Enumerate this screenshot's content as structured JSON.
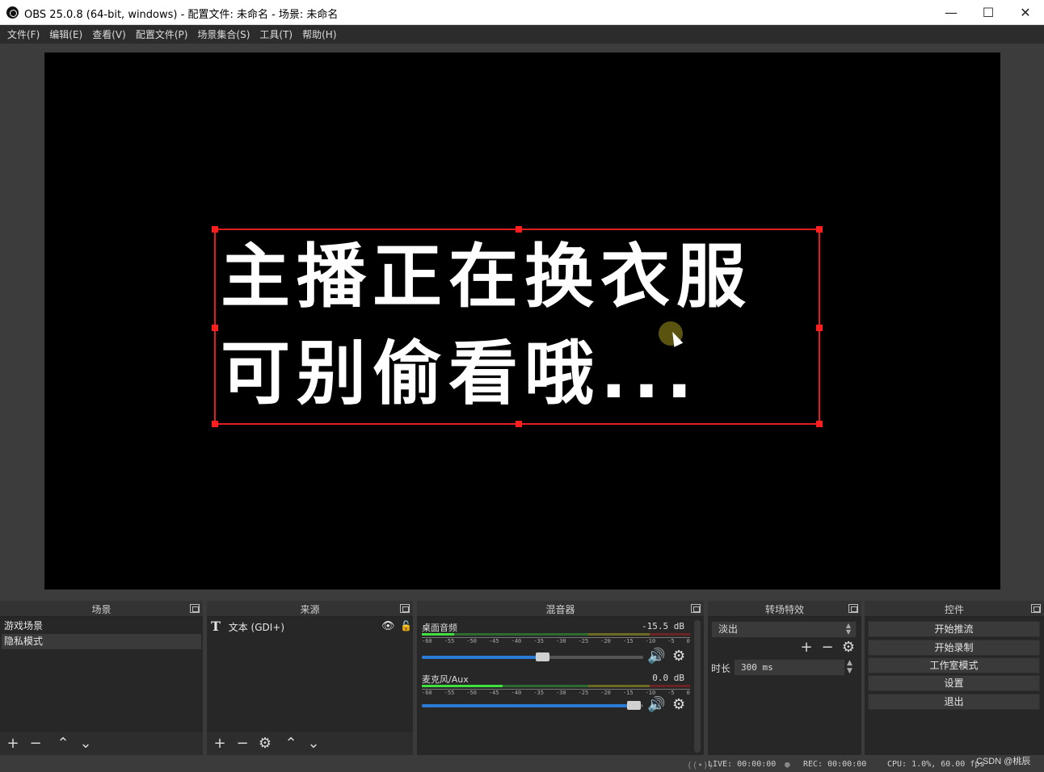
{
  "window": {
    "title": "OBS 25.0.8 (64-bit, windows) - 配置文件: 未命名 - 场景: 未命名",
    "minimize": "—",
    "maximize": "☐",
    "close": "✕"
  },
  "menu": [
    "文件(F)",
    "编辑(E)",
    "查看(V)",
    "配置文件(P)",
    "场景集合(S)",
    "工具(T)",
    "帮助(H)"
  ],
  "preview": {
    "overlay_line1": "主播正在换衣服",
    "overlay_line2": "可别偷看哦..."
  },
  "scenes": {
    "title": "场景",
    "items": [
      "游戏场景",
      "隐私模式"
    ],
    "selected_index": 1
  },
  "sources": {
    "title": "来源",
    "items": [
      {
        "label": "文本 (GDI+)",
        "icon": "text-icon",
        "visible": true,
        "locked": false
      }
    ]
  },
  "mixer": {
    "title": "混音器",
    "channels": [
      {
        "name": "桌面音频",
        "db": "-15.5 dB",
        "level": 0.12,
        "volume": 0.57
      },
      {
        "name": "麦克风/Aux",
        "db": "0.0 dB",
        "level": 0.3,
        "volume": 0.98
      }
    ],
    "ticks": [
      "-60",
      "-55",
      "-50",
      "-45",
      "-40",
      "-35",
      "-30",
      "-25",
      "-20",
      "-15",
      "-10",
      "-5",
      "0"
    ]
  },
  "transitions": {
    "title": "转场特效",
    "selected": "淡出",
    "duration_label": "时长",
    "duration_value": "300 ms"
  },
  "controls": {
    "title": "控件",
    "buttons": [
      "开始推流",
      "开始录制",
      "工作室模式",
      "设置",
      "退出"
    ]
  },
  "status": {
    "live": "LIVE: 00:00:00",
    "rec": "REC: 00:00:00",
    "cpu": "CPU: 1.0%, 60.00 fps",
    "watermark": "CSDN @桃辰"
  },
  "colors": {
    "selection_box": "#e11d1d",
    "volume_slider": "#2a7bd5",
    "meter_green": "#3fe03f"
  }
}
